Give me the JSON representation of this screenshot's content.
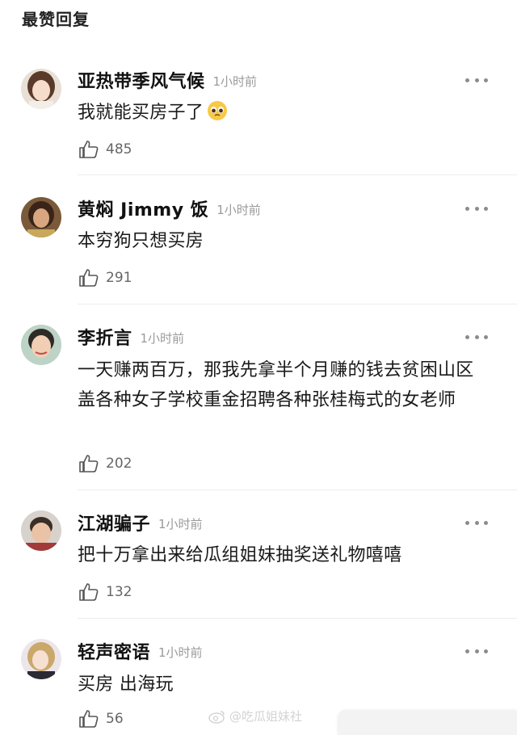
{
  "section": {
    "title": "最赞回复"
  },
  "comments": [
    {
      "name": "亚热带季风气候",
      "time": "1小时前",
      "text": "我就能买房子了",
      "emoji": "pleading-face-icon",
      "likes": "485"
    },
    {
      "name": "黄焖 Jimmy 饭",
      "time": "1小时前",
      "text": "本穷狗只想买房",
      "likes": "291"
    },
    {
      "name": "李折言",
      "time": "1小时前",
      "text": "一天赚两百万，那我先拿半个月赚的钱去贫困山区盖各种女子学校重金招聘各种张桂梅式的女老师",
      "likes": "202"
    },
    {
      "name": "江湖骗子",
      "time": "1小时前",
      "text": "把十万拿出来给瓜组姐妹抽奖送礼物嘻嘻",
      "likes": "132"
    },
    {
      "name": "轻声密语",
      "time": "1小时前",
      "text": "买房 出海玩",
      "likes": "56"
    }
  ],
  "watermark": {
    "text": "@吃瓜姐妹社"
  },
  "colors": {
    "meta": "#9a9a9a",
    "divider": "#ececec",
    "text": "#1a1a1a"
  }
}
